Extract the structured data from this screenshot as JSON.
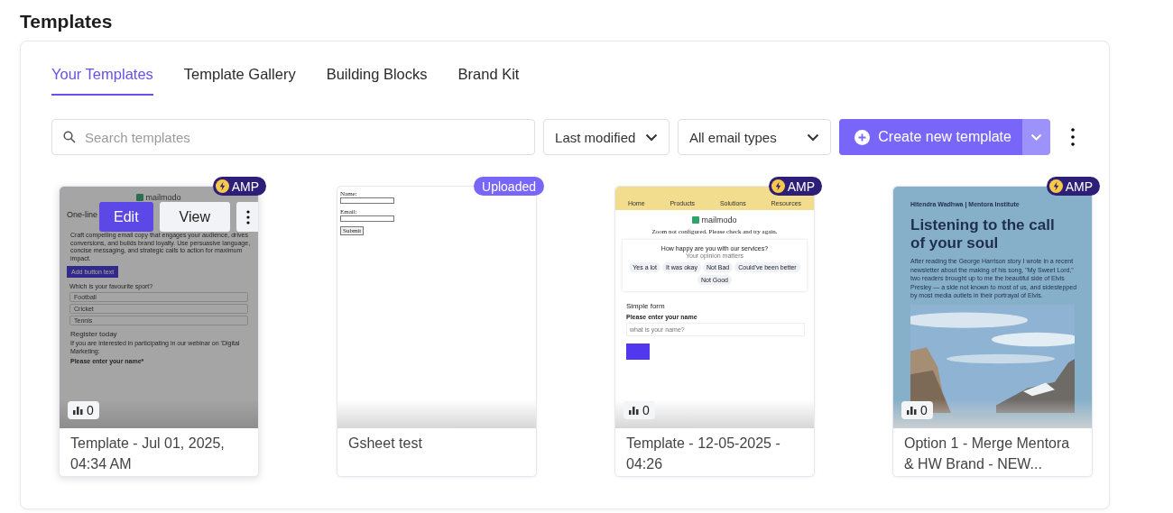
{
  "page_title": "Templates",
  "tabs": [
    {
      "label": "Your Templates",
      "selected": true
    },
    {
      "label": "Template Gallery",
      "selected": false
    },
    {
      "label": "Building Blocks",
      "selected": false
    },
    {
      "label": "Brand Kit",
      "selected": false
    }
  ],
  "search": {
    "placeholder": "Search templates"
  },
  "filters": [
    {
      "label": "Last modified"
    },
    {
      "label": "All email types"
    }
  ],
  "create_button": {
    "label": "Create new template"
  },
  "cards": [
    {
      "title": "Template - Jul 01, 2025, 04:34 AM",
      "badge": {
        "kind": "amp",
        "label": "AMP"
      },
      "hovered": true,
      "hover_actions": [
        "Edit",
        "View"
      ],
      "stats": "0",
      "preview": {
        "kind": "promo",
        "logo": "mailmodo",
        "heading": "One-line",
        "body": "Craft compelling email copy that engages your audience, drives conversions, and builds brand loyalty. Use persuasive language, concise messaging, and strategic calls to action for maximum impact.",
        "button": "Add button text",
        "question": "Which is your favourite sport?",
        "options": [
          "Football",
          "Cricket",
          "Tennis"
        ],
        "section": "Register today",
        "paragraph": "If you are interested in participating in our webinar on 'Digital Marketing:",
        "field_label": "Please enter your name*"
      }
    },
    {
      "title": "Gsheet test",
      "badge": {
        "kind": "uploaded",
        "label": "Uploaded"
      },
      "hovered": false,
      "preview": {
        "kind": "html",
        "fields": [
          "Name:",
          "Email:"
        ],
        "button": "Submit"
      }
    },
    {
      "title": "Template - 12-05-2025 - 04:26",
      "badge": {
        "kind": "amp",
        "label": "AMP"
      },
      "hovered": false,
      "stats": "0",
      "preview": {
        "kind": "survey",
        "nav": [
          "Home",
          "Products",
          "Solutions",
          "Resources"
        ],
        "logo": "mailmodo",
        "note": "Zoom not configured. Please check and try again.",
        "question": "How happy are you with our services?",
        "subtitle": "Your opinion matters",
        "options": [
          "Yes a lot",
          "It was okay",
          "Not Bad",
          "Could've been better",
          "Not Good"
        ],
        "section": "Simple form",
        "field_label": "Please enter your name",
        "placeholder": "what is your name?"
      }
    },
    {
      "title": "Option 1 - Merge Mentora & HW Brand - NEW...",
      "badge": {
        "kind": "amp",
        "label": "AMP"
      },
      "hovered": false,
      "stats": "0",
      "preview": {
        "kind": "newsletter",
        "byline": "Hitendra Wadhwa | Mentora Institute",
        "heading": "Listening to the call of your soul",
        "body": "After reading the George Harrison story I wrote in a recent newsletter about the making of his song, \"My Sweet Lord,\" two readers brought up to me the beautiful side of Elvis Presley — a side not known to most of us, and sidestepped by most media outlets in their portrayal of Elvis."
      }
    }
  ]
}
